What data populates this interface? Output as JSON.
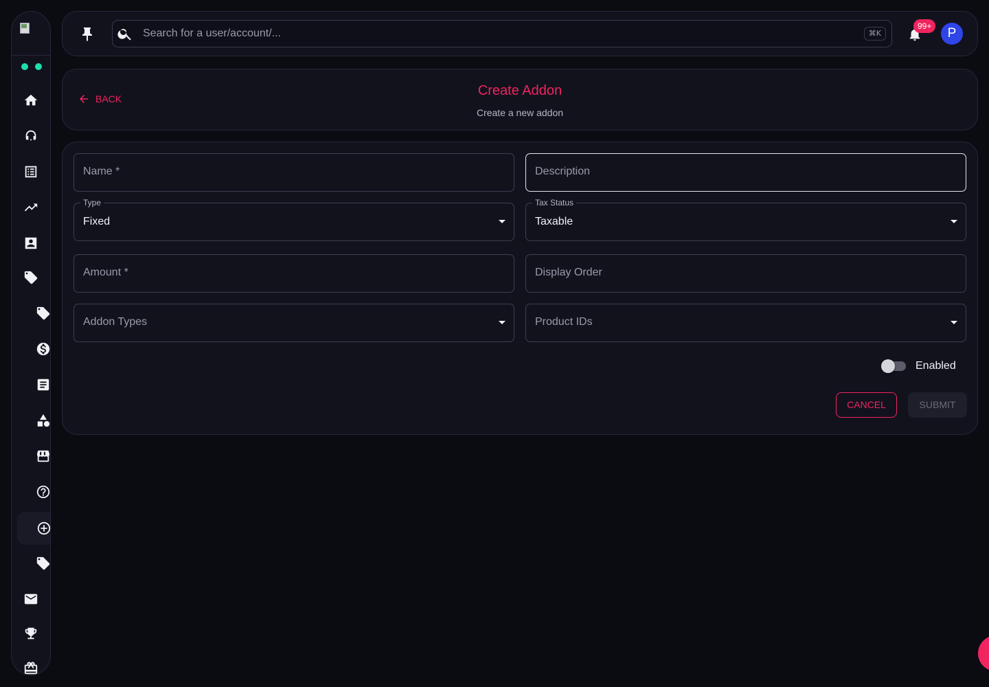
{
  "search": {
    "placeholder": "Search for a user/account/...",
    "shortcut": "⌘K"
  },
  "notifications": {
    "badge": "99+"
  },
  "user": {
    "initial": "P"
  },
  "header": {
    "back_label": "BACK",
    "title": "Create Addon",
    "subtitle": "Create a new addon"
  },
  "form": {
    "name_placeholder": "Name *",
    "description_placeholder": "Description",
    "type_label": "Type",
    "type_value": "Fixed",
    "tax_status_label": "Tax Status",
    "tax_status_value": "Taxable",
    "amount_placeholder": "Amount *",
    "display_order_placeholder": "Display Order",
    "addon_types_placeholder": "Addon Types",
    "product_ids_placeholder": "Product IDs",
    "enabled_label": "Enabled",
    "enabled": false,
    "cancel_label": "CANCEL",
    "submit_label": "SUBMIT"
  },
  "colors": {
    "accent": "#f0245e",
    "status_dot": "#1ee0a8",
    "avatar": "#2f45e8"
  },
  "sidebar_icons": [
    "home-icon",
    "headset-icon",
    "list-icon",
    "trending-up-icon",
    "contact-card-icon",
    "tag-icon",
    "tag-icon",
    "dollar-icon",
    "article-icon",
    "shapes-icon",
    "storefront-icon",
    "help-icon",
    "add-circle-icon",
    "tag-icon",
    "mail-icon",
    "trophy-icon",
    "gift-card-icon"
  ]
}
